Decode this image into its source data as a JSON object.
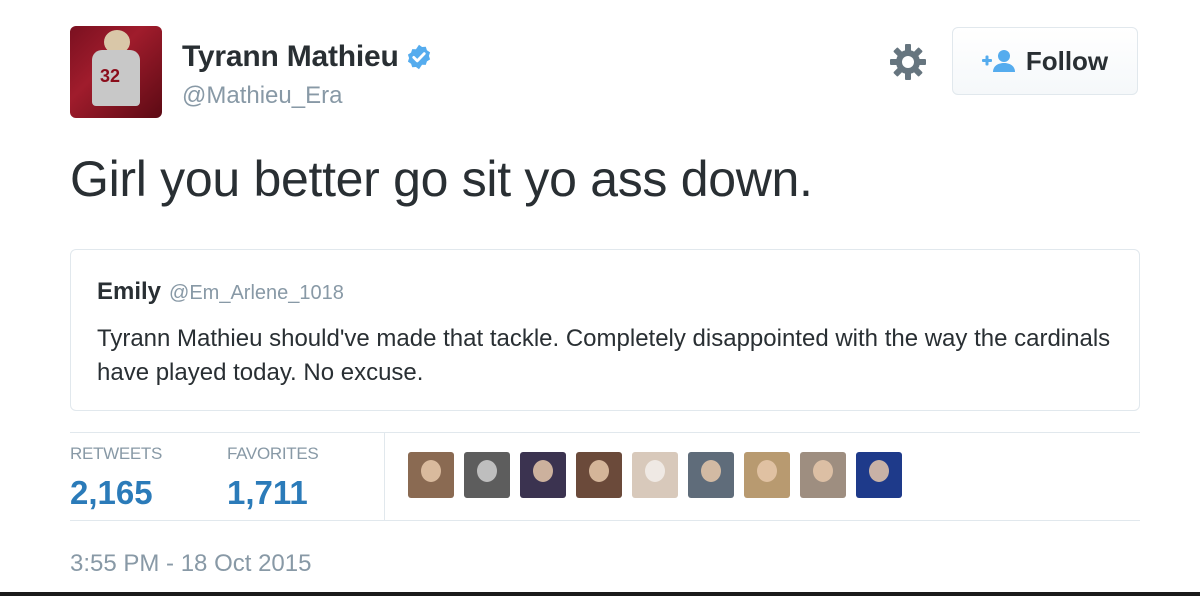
{
  "author": {
    "name": "Tyrann Mathieu",
    "handle": "@Mathieu_Era",
    "verified": true,
    "avatar_jersey_number": "32"
  },
  "actions": {
    "settings_icon": "gear-icon",
    "follow_label": "Follow",
    "follow_icon": "add-user-icon"
  },
  "tweet": {
    "text": "Girl you better go sit yo ass down."
  },
  "quoted_tweet": {
    "name": "Emily",
    "handle": "@Em_Arlene_1018",
    "text": "Tyrann Mathieu should've made that tackle. Completely disappointed with the way the cardinals have played today. No excuse."
  },
  "stats": {
    "retweets_label": "RETWEETS",
    "retweets_value": "2,165",
    "favorites_label": "FAVORITES",
    "favorites_value": "1,711"
  },
  "favoriters": [
    {
      "color": "#8a6a52"
    },
    {
      "color": "#5d5d5d"
    },
    {
      "color": "#3b3350"
    },
    {
      "color": "#6b4a3a"
    },
    {
      "color": "#d8c9bb"
    },
    {
      "color": "#5f6c7a"
    },
    {
      "color": "#b89a70"
    },
    {
      "color": "#9e8e80"
    },
    {
      "color": "#1e3a8a"
    }
  ],
  "timestamp": "3:55 PM - 18 Oct 2015",
  "colors": {
    "text": "#292f33",
    "muted": "#8899a6",
    "link": "#2b7bb9",
    "verified": "#55acee",
    "border": "#e1e8ed"
  }
}
